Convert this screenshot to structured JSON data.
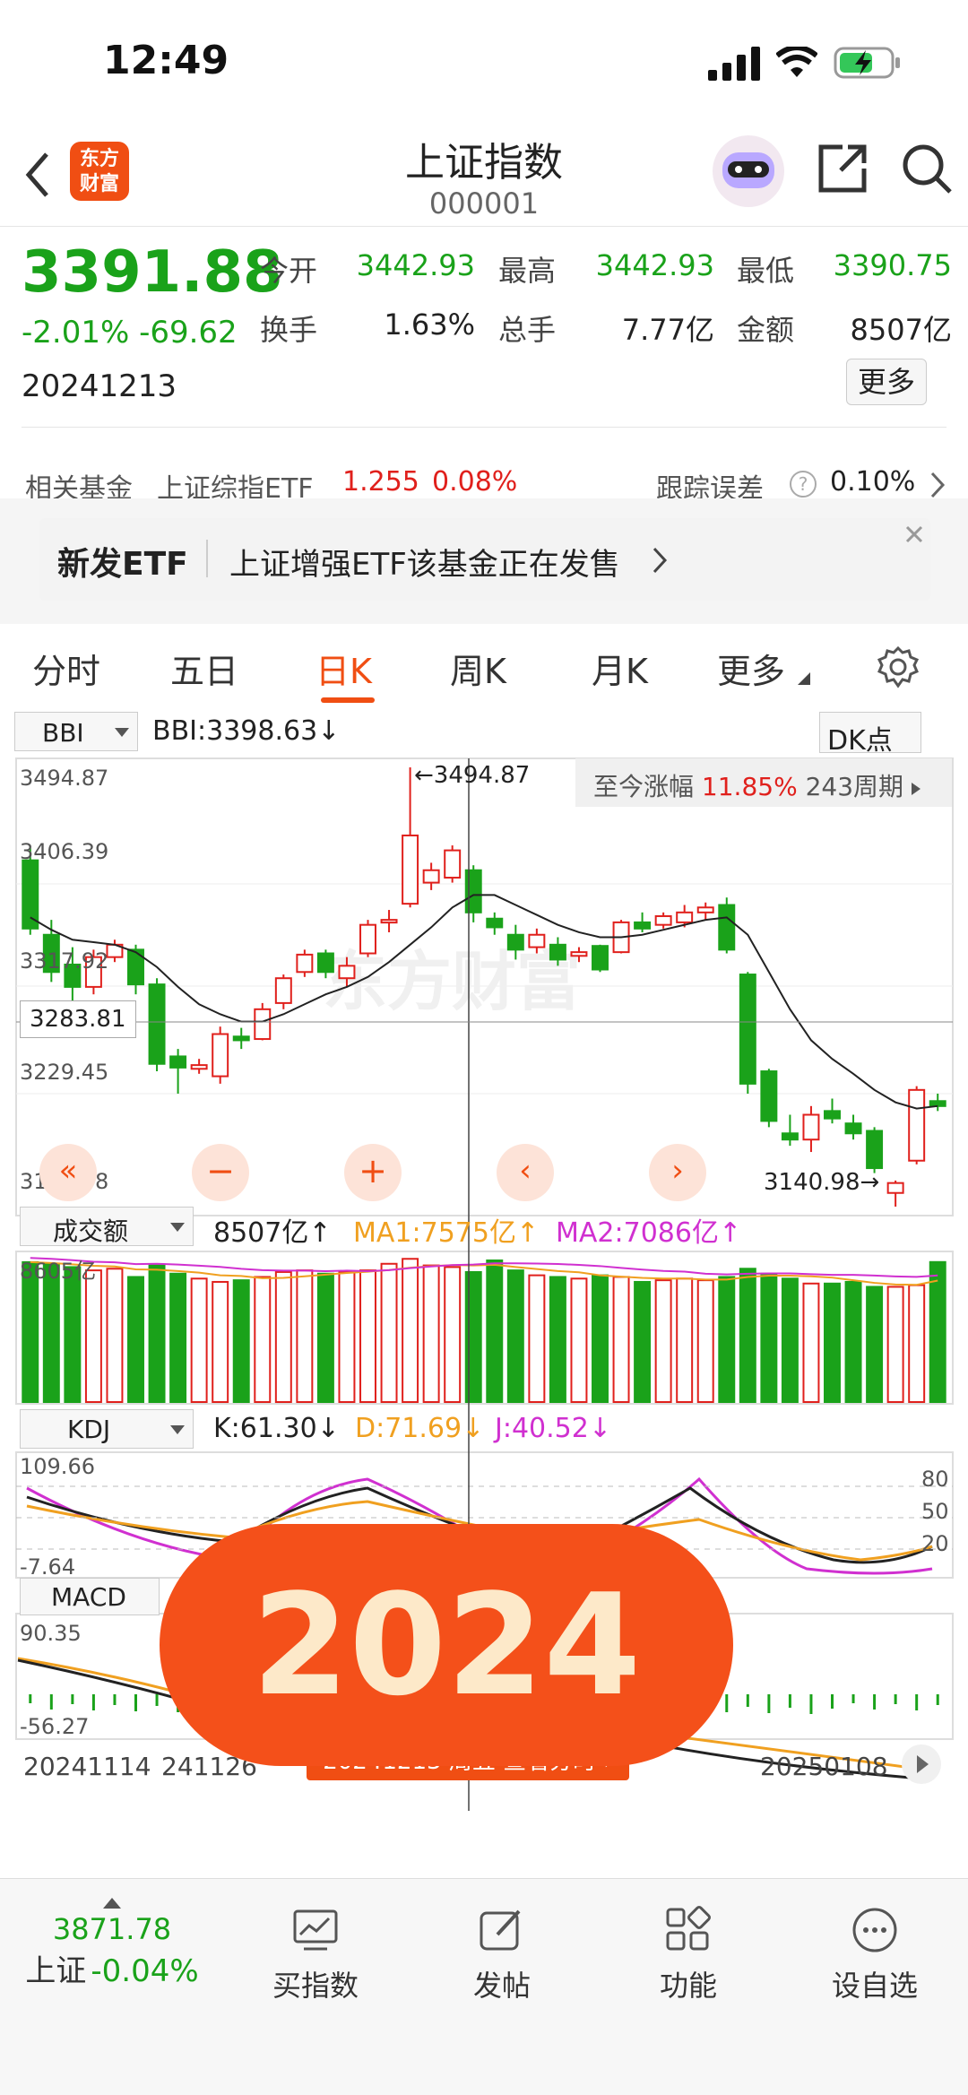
{
  "status": {
    "time": "12:49"
  },
  "header": {
    "logo": "东方\n财富",
    "title": "上证指数",
    "code": "000001"
  },
  "quote": {
    "price": "3391.88",
    "change": "-2.01% -69.62",
    "date": "20241213",
    "open_label": "今开",
    "open": "3442.93",
    "high_label": "最高",
    "high": "3442.93",
    "low_label": "最低",
    "low": "3390.75",
    "turnover_label": "换手",
    "turnover": "1.63%",
    "volume_label": "总手",
    "volume": "7.77亿",
    "amount_label": "金额",
    "amount": "8507亿",
    "more": "更多"
  },
  "fund": {
    "label": "相关基金",
    "name": "上证综指ETF",
    "price": "1.255",
    "pct": "0.08%",
    "track_label": "跟踪误差",
    "track": "0.10%"
  },
  "banner": {
    "tag": "新发ETF",
    "text": "上证增强ETF该基金正在发售"
  },
  "tabs": [
    "分时",
    "五日",
    "日K",
    "周K",
    "月K",
    "更多"
  ],
  "chart": {
    "indicator": "BBI",
    "bbi": "BBI:3398.63↓",
    "dk": "DK点",
    "range_label": "至今涨幅",
    "range_pct": "11.85%",
    "range_period": "243周期",
    "y_labels": [
      "3494.87",
      "3406.39",
      "3317.92",
      "3283.81",
      "3229.45",
      "3140.98"
    ],
    "hi_mark": "3494.87",
    "lo_mark": "3140.98",
    "vol_select": "成交额",
    "vol_value": "8507亿↑",
    "ma1": "MA1:7575亿↑",
    "ma2": "MA2:7086亿↑",
    "vol_max": "8605亿",
    "kdj_select": "KDJ",
    "k": "K:61.30↓",
    "d": "D:71.69↓",
    "j": "J:40.52↓",
    "kdj_hi": "109.66",
    "kdj_lo": "-7.64",
    "kdj_levels": [
      "80",
      "50",
      "20"
    ],
    "macd": "MACD",
    "macd_hi": "90.35",
    "macd_lo": "-56.27",
    "x_dates": [
      "20241114",
      "241126",
      "20250108"
    ],
    "tooltip": "20241213 周五 查看分时",
    "watermark": "东方财富",
    "colors": {
      "up": "#e0201c",
      "down": "#1aa21a",
      "ma1": "#f0a020",
      "ma2": "#d030d0"
    }
  },
  "chart_data": {
    "type": "candlestick",
    "candles": [
      [
        3420,
        3365,
        3430,
        3360
      ],
      [
        3360,
        3330,
        3372,
        3322
      ],
      [
        3336,
        3318,
        3350,
        3302
      ],
      [
        3318,
        3342,
        3348,
        3312
      ],
      [
        3342,
        3352,
        3356,
        3338
      ],
      [
        3348,
        3320,
        3352,
        3312
      ],
      [
        3320,
        3256,
        3325,
        3250
      ],
      [
        3262,
        3253,
        3268,
        3232
      ],
      [
        3252,
        3255,
        3260,
        3248
      ],
      [
        3246,
        3280,
        3286,
        3240
      ],
      [
        3278,
        3275,
        3285,
        3268
      ],
      [
        3276,
        3300,
        3305,
        3275
      ],
      [
        3305,
        3325,
        3328,
        3300
      ],
      [
        3330,
        3344,
        3348,
        3326
      ],
      [
        3345,
        3330,
        3348,
        3325
      ],
      [
        3325,
        3335,
        3342,
        3318
      ],
      [
        3345,
        3368,
        3372,
        3342
      ],
      [
        3370,
        3372,
        3380,
        3362
      ],
      [
        3385,
        3440,
        3494.87,
        3382
      ],
      [
        3402,
        3412,
        3418,
        3396
      ],
      [
        3406,
        3428,
        3432,
        3402
      ],
      [
        3412,
        3378,
        3416,
        3370
      ],
      [
        3373,
        3366,
        3378,
        3360
      ],
      [
        3360,
        3348,
        3368,
        3340
      ],
      [
        3350,
        3360,
        3365,
        3345
      ],
      [
        3352,
        3340,
        3358,
        3335
      ],
      [
        3343,
        3346,
        3350,
        3338
      ],
      [
        3351,
        3332,
        3352,
        3330
      ],
      [
        3346,
        3370,
        3372,
        3345
      ],
      [
        3370,
        3365,
        3378,
        3362
      ],
      [
        3368,
        3375,
        3378,
        3365
      ],
      [
        3370,
        3378,
        3384,
        3366
      ],
      [
        3378,
        3382,
        3386,
        3372
      ],
      [
        3384,
        3348,
        3390,
        3345
      ],
      [
        3328,
        3240,
        3330,
        3232
      ],
      [
        3250,
        3210,
        3252,
        3205
      ],
      [
        3200,
        3195,
        3215,
        3190
      ],
      [
        3195,
        3215,
        3222,
        3185
      ],
      [
        3218,
        3212,
        3228,
        3208
      ],
      [
        3208,
        3200,
        3215,
        3195
      ],
      [
        3202,
        3172,
        3205,
        3168
      ],
      [
        3152,
        3160,
        3162,
        3140.98
      ],
      [
        3178,
        3235,
        3238,
        3175
      ],
      [
        3226,
        3222,
        3232,
        3218
      ]
    ],
    "bbi": [
      3374,
      3364,
      3356,
      3354,
      3352,
      3346,
      3334,
      3318,
      3304,
      3296,
      3290,
      3290,
      3296,
      3304,
      3312,
      3318,
      3326,
      3338,
      3352,
      3366,
      3382,
      3392,
      3392,
      3384,
      3376,
      3368,
      3362,
      3358,
      3358,
      3360,
      3364,
      3368,
      3372,
      3374,
      3360,
      3330,
      3300,
      3275,
      3260,
      3248,
      3235,
      3225,
      3220,
      3222
    ],
    "volume": [
      8500,
      8400,
      8200,
      8000,
      8100,
      7600,
      8300,
      7800,
      7500,
      7300,
      7400,
      7600,
      7900,
      8000,
      7800,
      7900,
      8000,
      8400,
      8700,
      8300,
      8200,
      7900,
      8605,
      8000,
      7700,
      7600,
      7500,
      7700,
      7600,
      7300,
      7400,
      7500,
      7400,
      7600,
      8100,
      7800,
      7500,
      7200,
      7200,
      7300,
      7000,
      7000,
      7100,
      8507
    ],
    "ylim": [
      3140.98,
      3494.87
    ]
  },
  "nav": {
    "index_value": "3871.78",
    "index_name": "上证",
    "index_pct": "-0.04%",
    "items": [
      "买指数",
      "发帖",
      "功能",
      "设自选"
    ]
  },
  "overlay": {
    "stamp": "2024"
  }
}
